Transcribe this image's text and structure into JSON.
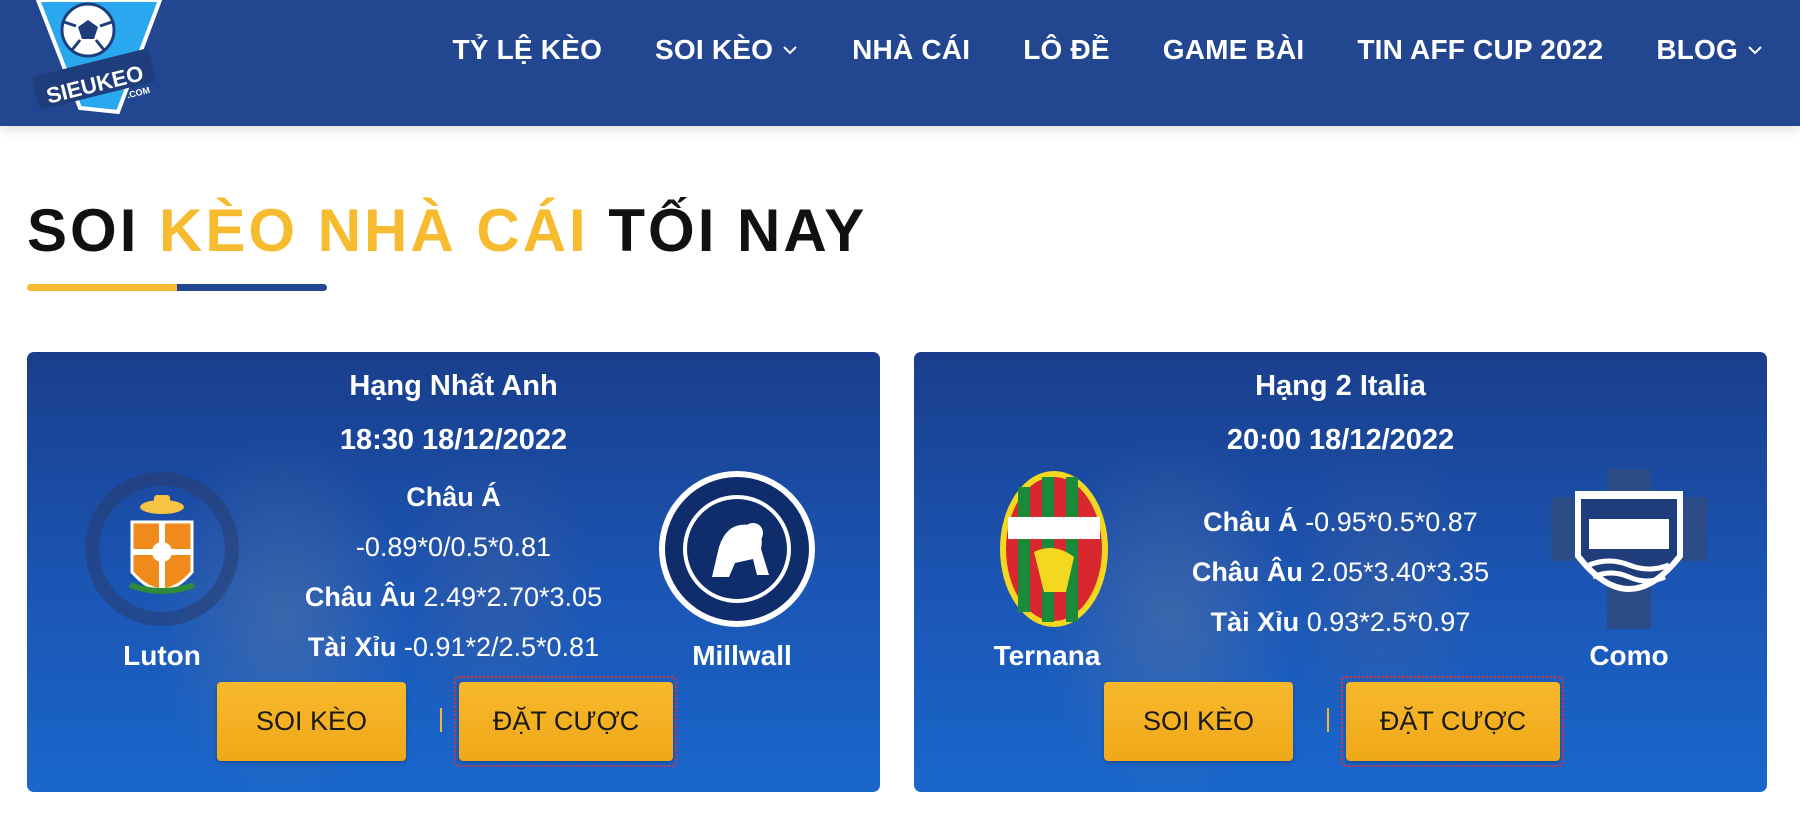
{
  "header": {
    "logo_text": "SIEUKEO",
    "logo_sub": ".COM",
    "nav": [
      {
        "label": "TỶ LỆ KÈO",
        "dropdown": false
      },
      {
        "label": "SOI KÈO",
        "dropdown": true
      },
      {
        "label": "NHÀ CÁI",
        "dropdown": false
      },
      {
        "label": "LÔ ĐỀ",
        "dropdown": false
      },
      {
        "label": "GAME BÀI",
        "dropdown": false
      },
      {
        "label": "TIN AFF CUP 2022",
        "dropdown": false
      },
      {
        "label": "BLOG",
        "dropdown": true
      }
    ]
  },
  "section": {
    "title_part1": "SOI",
    "title_accent": "KÈO NHÀ CÁI",
    "title_part2": "TỐI NAY"
  },
  "colors": {
    "header_bg": "#22468f",
    "accent_yellow": "#f6bb2f",
    "card_blue": "#1b56b5"
  },
  "matches": [
    {
      "league": "Hạng Nhất Anh",
      "datetime": "18:30 18/12/2022",
      "home": {
        "name": "Luton",
        "logo_icon": "luton-town-crest-icon"
      },
      "away": {
        "name": "Millwall",
        "logo_icon": "millwall-crest-icon"
      },
      "asia_label": "Châu Á",
      "asia_value": "-0.89*0/0.5*0.81",
      "euro_label": "Châu Âu",
      "euro_value": "2.49*2.70*3.05",
      "ou_label": "Tài Xỉu",
      "ou_value": "-0.91*2/2.5*0.81",
      "btn_soi": "SOI KÈO",
      "btn_dat": "ĐẶT CƯỢC"
    },
    {
      "league": "Hạng 2 Italia",
      "datetime": "20:00 18/12/2022",
      "home": {
        "name": "Ternana",
        "logo_icon": "ternana-crest-icon"
      },
      "away": {
        "name": "Como",
        "logo_icon": "como-crest-icon"
      },
      "asia_label": "Châu Á",
      "asia_value": "-0.95*0.5*0.87",
      "euro_label": "Châu Âu",
      "euro_value": "2.05*3.40*3.35",
      "ou_label": "Tài Xỉu",
      "ou_value": "0.93*2.5*0.97",
      "btn_soi": "SOI KÈO",
      "btn_dat": "ĐẶT CƯỢC"
    }
  ]
}
